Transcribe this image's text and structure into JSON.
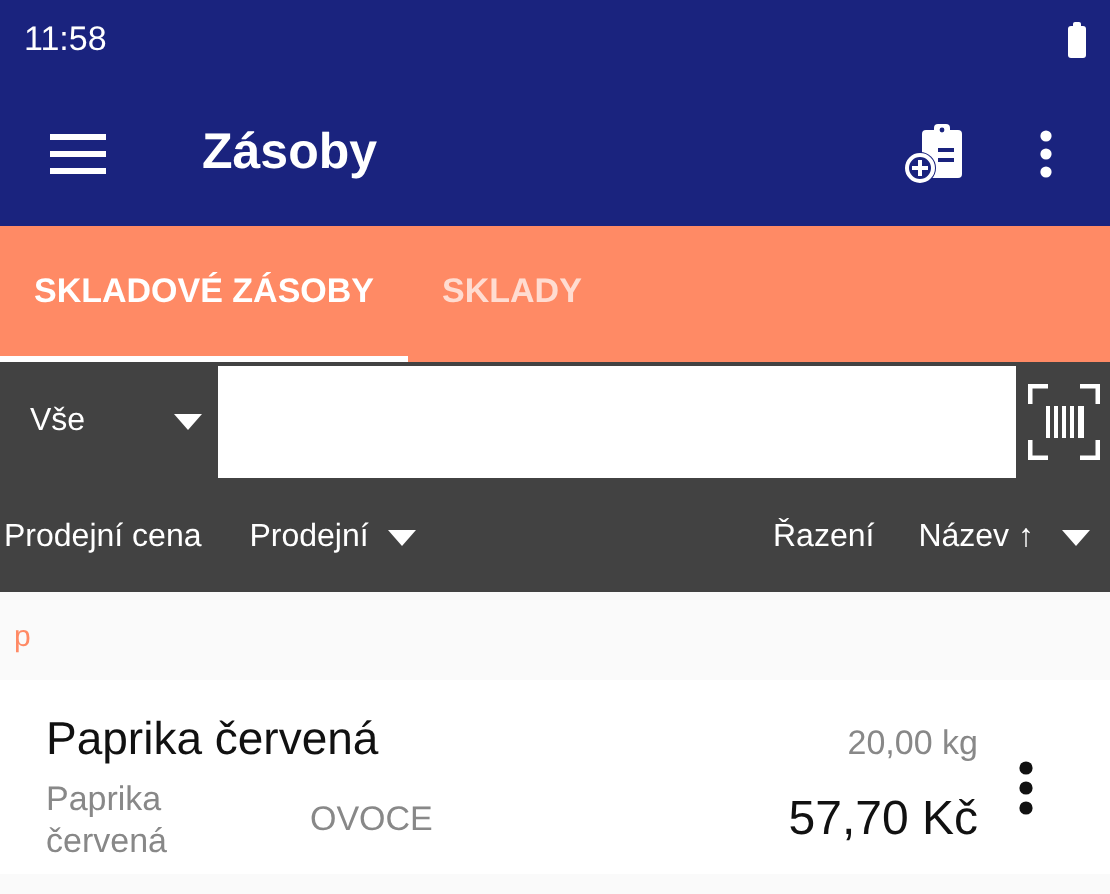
{
  "status_bar": {
    "time": "11:58"
  },
  "app_bar": {
    "title": "Zásoby"
  },
  "tabs": [
    {
      "label": "SKLADOVÉ ZÁSOBY",
      "selected": true
    },
    {
      "label": "SKLADY",
      "selected": false
    }
  ],
  "filter": {
    "category": "Vše",
    "price_label": "Prodejní cena",
    "price_type": "Prodejní",
    "sort_label": "Řazení",
    "sort_value": "Název ↑"
  },
  "sections": [
    {
      "header": "p",
      "items": [
        {
          "name": "Paprika červená",
          "quantity": "20,00 kg",
          "subtitle": "Paprika červená",
          "group": "OVOCE",
          "price": "57,70 Kč"
        }
      ]
    }
  ]
}
